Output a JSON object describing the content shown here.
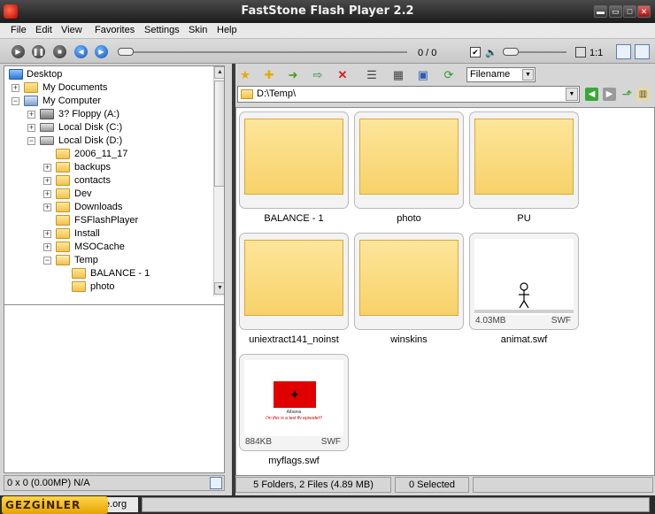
{
  "window": {
    "title": "FastStone Flash Player 2.2"
  },
  "menu": [
    "File",
    "Edit",
    "View",
    "Favorites",
    "Settings",
    "Skin",
    "Help"
  ],
  "player": {
    "counter": "0 / 0",
    "ratio_label": "1:1",
    "loop_checked": true,
    "seek_position": 0,
    "volume_level": 0
  },
  "tree": {
    "items": [
      {
        "label": "Desktop",
        "icon": "desktop-icon",
        "expander": ""
      },
      {
        "label": "My Documents",
        "icon": "documents-icon",
        "expander": "+"
      },
      {
        "label": "My Computer",
        "icon": "computer-icon",
        "expander": "−"
      },
      {
        "label": "3? Floppy (A:)",
        "icon": "floppy-icon",
        "expander": "+"
      },
      {
        "label": "Local Disk (C:)",
        "icon": "drive-icon",
        "expander": "+"
      },
      {
        "label": "Local Disk (D:)",
        "icon": "drive-icon",
        "expander": "−"
      },
      {
        "label": "2006_11_17",
        "icon": "folder-icon",
        "expander": ""
      },
      {
        "label": "backups",
        "icon": "folder-icon",
        "expander": "+"
      },
      {
        "label": "contacts",
        "icon": "folder-icon",
        "expander": "+"
      },
      {
        "label": "Dev",
        "icon": "folder-icon",
        "expander": "+"
      },
      {
        "label": "Downloads",
        "icon": "folder-icon",
        "expander": "+"
      },
      {
        "label": "FSFlashPlayer",
        "icon": "folder-icon",
        "expander": ""
      },
      {
        "label": "Install",
        "icon": "folder-icon",
        "expander": "+"
      },
      {
        "label": "MSOCache",
        "icon": "folder-icon",
        "expander": "+"
      },
      {
        "label": "Temp",
        "icon": "open-folder-icon",
        "expander": "−"
      },
      {
        "label": "BALANCE - 1",
        "icon": "folder-icon",
        "expander": ""
      },
      {
        "label": "photo",
        "icon": "folder-icon",
        "expander": ""
      }
    ]
  },
  "left_status": {
    "info": "0 x 0 (0.00MP) N/A"
  },
  "right_toolbar": {
    "sort_value": "Filename"
  },
  "path": {
    "value": "D:\\Temp\\"
  },
  "thumbnails": [
    {
      "caption": "BALANCE - 1",
      "type": "folder"
    },
    {
      "caption": "photo",
      "type": "folder"
    },
    {
      "caption": "PU",
      "type": "folder"
    },
    {
      "caption": "uniextract141_noinst",
      "type": "folder"
    },
    {
      "caption": "winskins",
      "type": "folder"
    },
    {
      "caption": "animat.swf",
      "type": "swf",
      "size": "4.03MB",
      "kind": "SWF"
    },
    {
      "caption": "myflags.swf",
      "type": "swf",
      "size": "884KB",
      "kind": "SWF",
      "flag_text_1": "Albania",
      "flag_text_2": "I'm this is a test flv episode!!!"
    }
  ],
  "right_status": {
    "summary": "5 Folders, 2 Files (4.89 MB)",
    "selected": "0 Selected"
  },
  "bottom": {
    "watermark": "GEZGİNLER",
    "site_fragment": "e.org"
  },
  "colors": {
    "folder_fill": "#f7d26a",
    "titlebar": "#1c1c1c",
    "flag_red": "#e00000"
  }
}
